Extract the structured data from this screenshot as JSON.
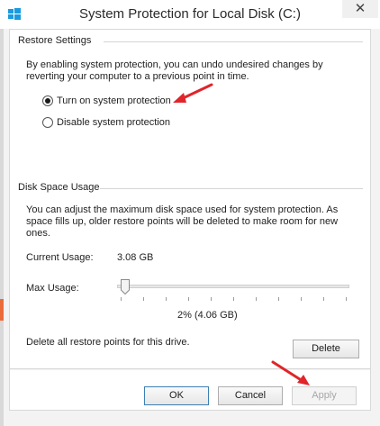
{
  "window": {
    "title": "System Protection for Local Disk (C:)",
    "close_glyph": "✕"
  },
  "restore_settings": {
    "title": "Restore Settings",
    "description": "By enabling system protection, you can undo undesired changes by reverting your computer to a previous point in time.",
    "options": [
      {
        "label": "Turn on system protection",
        "checked": true
      },
      {
        "label": "Disable system protection",
        "checked": false
      }
    ]
  },
  "disk_space": {
    "title": "Disk Space Usage",
    "description": "You can adjust the maximum disk space used for system protection. As space fills up, older restore points will be deleted to make room for new ones.",
    "current_usage_label": "Current Usage:",
    "current_usage_value": "3.08 GB",
    "max_usage_label": "Max Usage:",
    "max_usage_fraction": 0.02,
    "max_usage_readout": "2% (4.06 GB)",
    "delete_text": "Delete all restore points for this drive.",
    "delete_label": "Delete"
  },
  "buttons": {
    "ok": "OK",
    "cancel": "Cancel",
    "apply": "Apply"
  },
  "colors": {
    "annotation_arrow": "#e0252b",
    "accent": "#3c7fb1"
  },
  "icons": {
    "app": "windows-logo-icon",
    "annotation": "red-arrow-icon",
    "slider": "slider-thumb-icon"
  }
}
